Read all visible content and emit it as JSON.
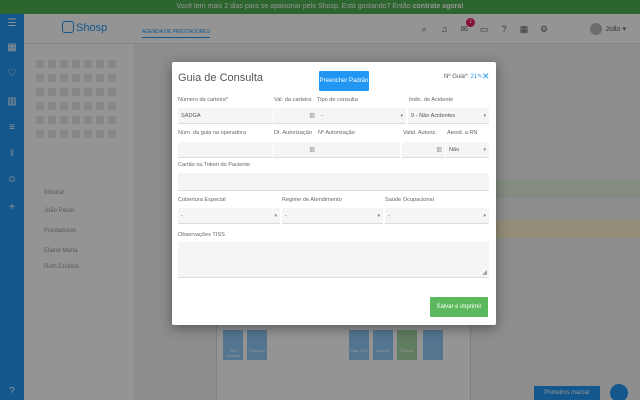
{
  "banner": {
    "text": "Você tem mais 2 dias para se apaixonar pelo Shosp. Está gostando? Então ",
    "link": "contrate agora!"
  },
  "sidebar": {
    "icons": [
      "menu-icon",
      "calendar-icon",
      "heart-icon",
      "book-icon",
      "database-icon",
      "stethoscope-icon",
      "user-icon",
      "plus-icon",
      "help-icon"
    ]
  },
  "header": {
    "logo": "Shosp",
    "tab": "AGENDA DE PRESTADORES",
    "notification_badge": "1",
    "user_name": "João"
  },
  "background": {
    "sidebar_items": [
      "Mostrar",
      "João Paulo",
      "Prestadores",
      "Eliane Maria",
      "Ruth Cristina"
    ],
    "bottom_buttons": [
      "Dar entrada",
      "Registrar",
      "Guia TISS",
      "Atender",
      "Finalizar"
    ],
    "next_button": "Primeiros marcar"
  },
  "modal": {
    "title": "Guia de Consulta",
    "fill_button": "Preencher Padrão",
    "nguia_label": "Nº Guia*:",
    "nguia_value": "21",
    "fields": {
      "numero_carteira": {
        "label": "Número da carteira*",
        "value": "SADGA"
      },
      "val_carteira": {
        "label": "Val. da carteira",
        "value": ""
      },
      "tipo_consulta": {
        "label": "Tipo de consulta",
        "value": "-"
      },
      "indic_acidente": {
        "label": "Indic. de Acidente",
        "value": "9 - Não Acidentes"
      },
      "num_guia_operadora": {
        "label": "Núm. da guia na operadora",
        "value": ""
      },
      "dt_autorizacao": {
        "label": "Dt. Autorização",
        "value": ""
      },
      "n_autorizacao": {
        "label": "Nº Autorização",
        "value": ""
      },
      "valid_autoriz": {
        "label": "Valid. Autoriz.",
        "value": ""
      },
      "atend_rn": {
        "label": "Atend. a RN",
        "value": "Não"
      },
      "cartao_token": {
        "label": "Cartão ou Token do Paciente",
        "value": ""
      },
      "cobertura_especial": {
        "label": "Cobertura Especial",
        "value": "-"
      },
      "regime_atendimento": {
        "label": "Regime de Atendimento",
        "value": "-"
      },
      "saude_ocupacional": {
        "label": "Saúde Ocupacional",
        "value": "-"
      },
      "observacoes": {
        "label": "Observações TISS",
        "value": ""
      }
    },
    "save_button": "Salvar e imprimir"
  }
}
